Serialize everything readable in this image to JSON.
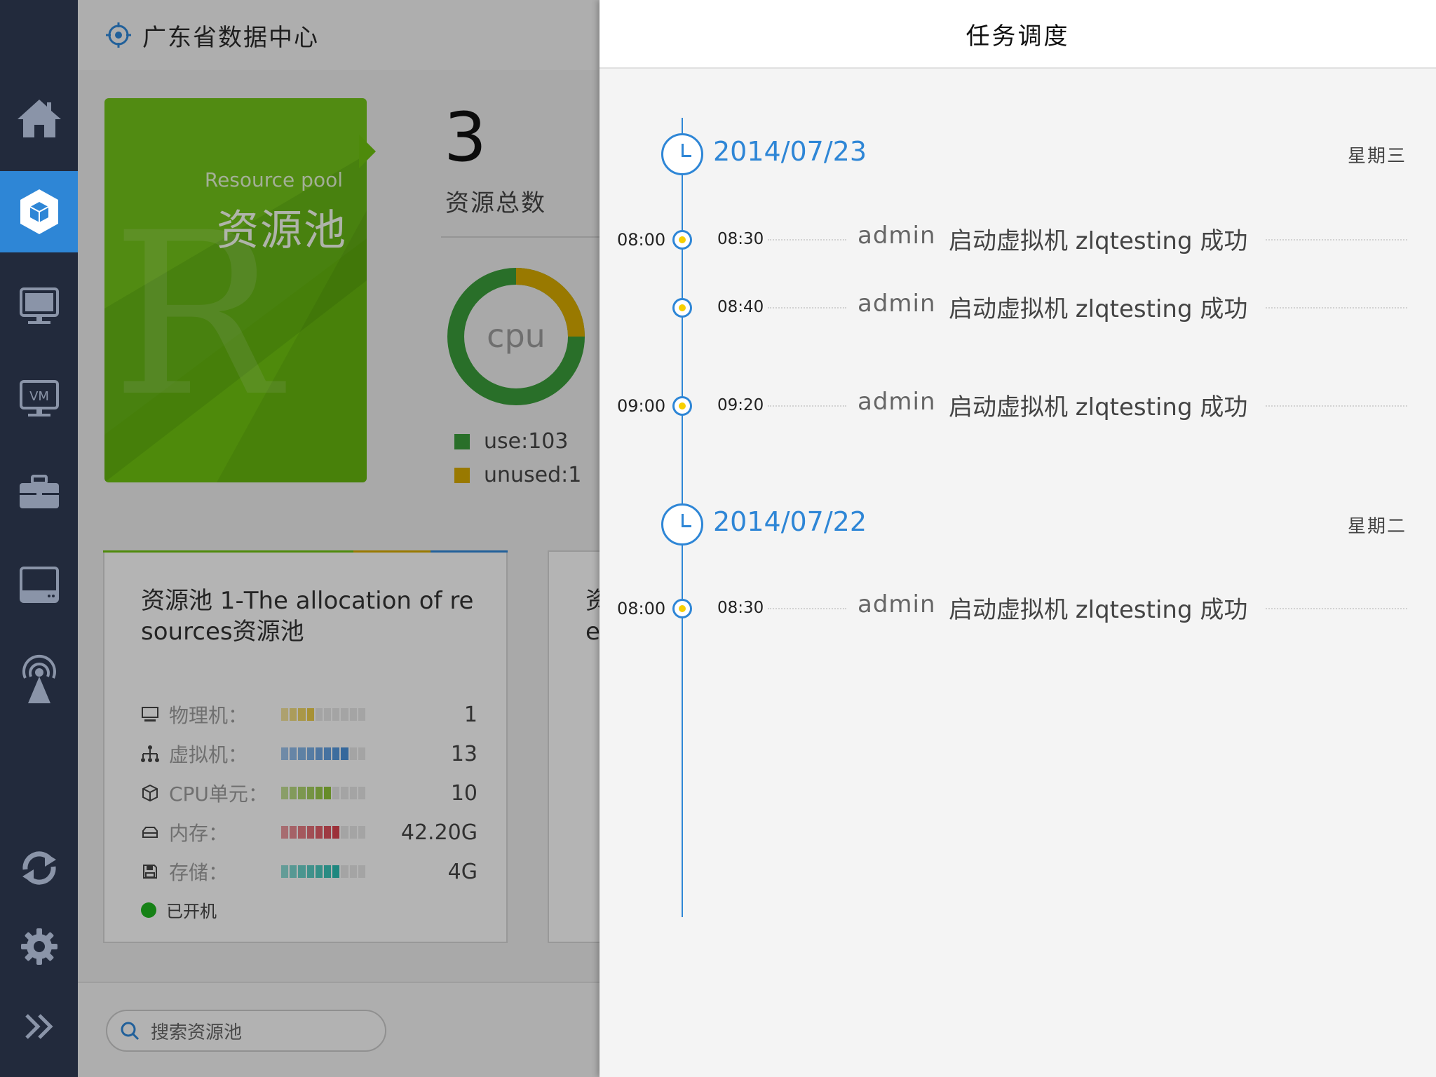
{
  "header": {
    "title": "广东省数据中心"
  },
  "sidebar": {
    "items": [
      {
        "name": "home-icon"
      },
      {
        "name": "cube-icon",
        "active": true
      },
      {
        "name": "monitor-icon"
      },
      {
        "name": "vm-icon",
        "text": "VM"
      },
      {
        "name": "briefcase-icon"
      },
      {
        "name": "storage-icon"
      },
      {
        "name": "broadcast-icon"
      },
      {
        "name": "refresh-icon"
      },
      {
        "name": "gear-icon"
      },
      {
        "name": "expand-icon"
      }
    ]
  },
  "pool_card": {
    "en_label": "Resource pool",
    "zh_label": "资源池",
    "watermark": "R",
    "color": "#6cbf10"
  },
  "summary": {
    "total_number": "3",
    "total_label": "资源总数",
    "donut_label": "cpu",
    "use_label": "use:103",
    "unused_label": "unused:1",
    "use_value": 103,
    "unused_value": 1,
    "use_color": "#3a9a3a",
    "unused_color": "#d4a800"
  },
  "resource_card": {
    "title": "资源池  1-The allocation of resources资源池",
    "rows": [
      {
        "icon": "monitor-icon",
        "label": "物理机：",
        "value": "1",
        "level": 0.4,
        "color": "#e8c94a"
      },
      {
        "icon": "network-icon",
        "label": "虚拟机：",
        "value": "13",
        "level": 0.8,
        "color": "#4a90d9"
      },
      {
        "icon": "cube-icon",
        "label": "CPU单元：",
        "value": "10",
        "level": 0.6,
        "color": "#8fc23a"
      },
      {
        "icon": "memory-icon",
        "label": "内存：",
        "value": "42.20G",
        "level": 0.7,
        "color": "#d9434f"
      },
      {
        "icon": "disk-icon",
        "label": "存储：",
        "value": "4G",
        "level": 0.7,
        "color": "#2bbcb0"
      }
    ],
    "status": "已开机"
  },
  "second_card": {
    "partial_title": "资\ne"
  },
  "search": {
    "placeholder": "搜索资源池"
  },
  "panel": {
    "title": "任务调度",
    "days": [
      {
        "date": "2014/07/23",
        "weekday": "星期三",
        "events": [
          {
            "hour": "08:00",
            "time": "08:30",
            "user": "admin",
            "msg": "启动虚拟机 zlqtesting 成功"
          },
          {
            "hour": "",
            "time": "08:40",
            "user": "admin",
            "msg": "启动虚拟机 zlqtesting 成功"
          },
          {
            "hour": "09:00",
            "time": "09:20",
            "user": "admin",
            "msg": "启动虚拟机 zlqtesting 成功"
          }
        ]
      },
      {
        "date": "2014/07/22",
        "weekday": "星期二",
        "events": [
          {
            "hour": "08:00",
            "time": "08:30",
            "user": "admin",
            "msg": "启动虚拟机 zlqtesting 成功"
          }
        ]
      }
    ]
  }
}
